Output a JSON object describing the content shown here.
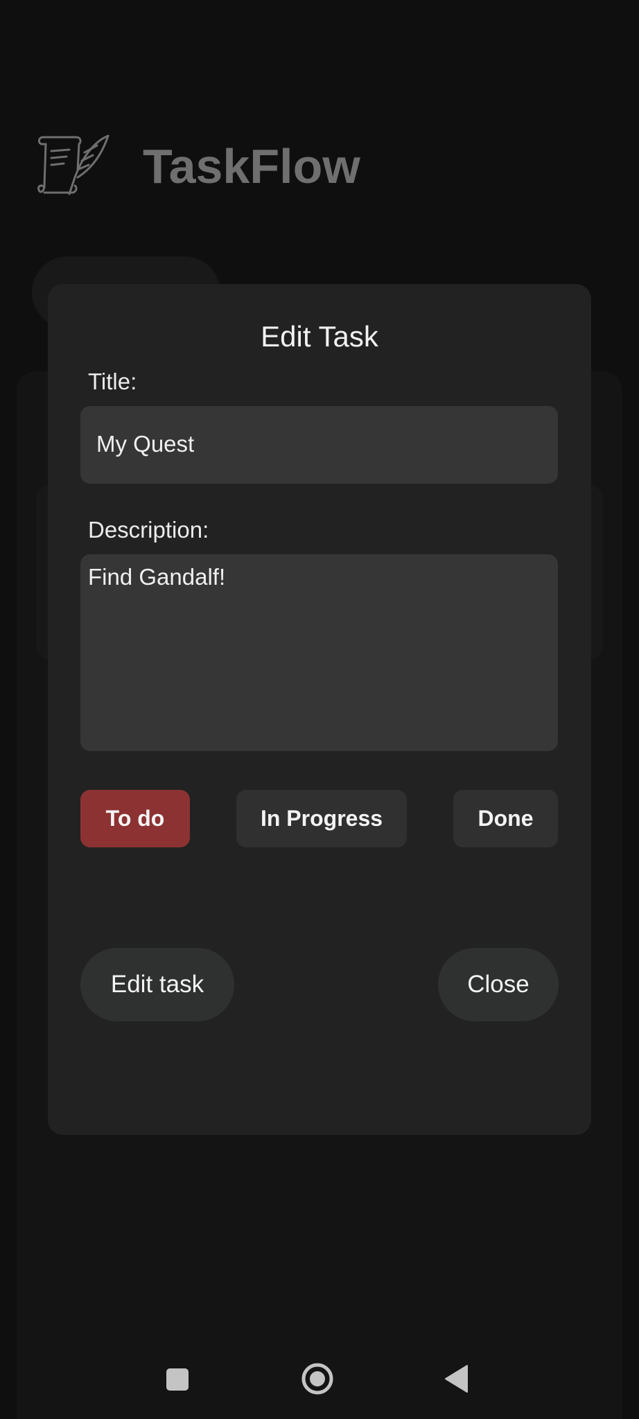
{
  "app": {
    "title": "TaskFlow",
    "logo_icon": "scroll-quill-icon"
  },
  "modal": {
    "title": "Edit Task",
    "title_label": "Title:",
    "title_value": "My Quest",
    "description_label": "Description:",
    "description_value": "Find Gandalf!",
    "status_options": [
      {
        "label": "To do",
        "selected": true
      },
      {
        "label": "In Progress",
        "selected": false
      },
      {
        "label": "Done",
        "selected": false
      }
    ],
    "edit_button_label": "Edit task",
    "close_button_label": "Close"
  },
  "nav": {
    "recents_icon": "square-icon",
    "home_icon": "circle-home-icon",
    "back_icon": "triangle-back-icon"
  },
  "colors": {
    "selected_status": "#8c3232",
    "modal_background": "#222222",
    "input_background": "#363636"
  }
}
